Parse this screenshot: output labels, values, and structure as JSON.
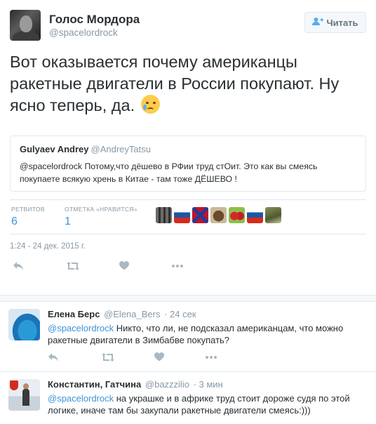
{
  "tweet": {
    "author_name": "Голос Мордора",
    "author_handle": "@spacelordrock",
    "follow_label": "Читать",
    "text": "Вот оказывается почему американцы ракетные двигатели в России покупают. Ну ясно теперь, да.",
    "emoji": "crying-face-emoji",
    "quote": {
      "author_name": "Gulyaev Andrey",
      "author_handle": "@AndreyTatsu",
      "text": "@spacelordrock Потому,что дёшево в РФии труд стОит. Это как вы смеясь покупаете всякую хрень в Китае - там тоже ДЁШЕВО !"
    },
    "stats": {
      "retweets_label": "РЕТВИТОВ",
      "retweets_value": "6",
      "likes_label": "ОТМЕТКА «НРАВИТСЯ»",
      "likes_value": "1"
    },
    "timestamp": "1:24 - 24 дек. 2015 г."
  },
  "replies": [
    {
      "author_name": "Елена Берс",
      "author_handle": "@Elena_Bers",
      "time": "· 24 сек",
      "mention": "@spacelordrock",
      "text": " Никто, что ли, не подсказал американцам, что можно ракетные двигатели в Зимбабве покупать?"
    },
    {
      "author_name": "Константин, Гатчина",
      "author_handle": "@bazzzilio",
      "time": "· 3 мин",
      "mention": "@spacelordrock",
      "text": " на укрaшке и в африке труд стоит дороже судя по этой логике, иначе там бы закупали ракетные двигатели смеясь:)))"
    }
  ],
  "colors": {
    "link": "#3b94d9",
    "muted": "#8899a6",
    "text": "#292f33",
    "border": "#e1e8ed"
  }
}
